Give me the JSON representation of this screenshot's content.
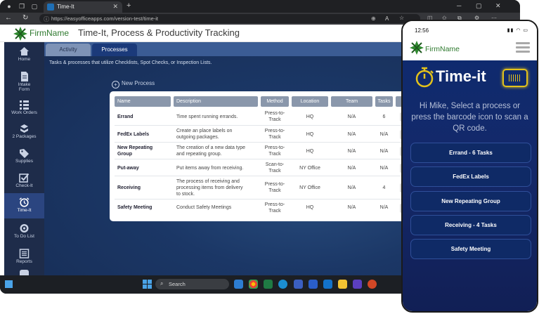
{
  "browser": {
    "tab_title": "Time-It",
    "url_host": "https://easyofficeapps.com",
    "url_path": "/version-test/time-it"
  },
  "app": {
    "logo_text": "FirmName",
    "title": "Time-It, Process & Productivity Tracking"
  },
  "sidebar": {
    "items": [
      {
        "label": "Home",
        "icon": "home-icon"
      },
      {
        "label": "Intake\nForm",
        "icon": "document-icon"
      },
      {
        "label": "Work Orders",
        "icon": "list-icon"
      },
      {
        "label": "2 Packages",
        "icon": "boxes-icon"
      },
      {
        "label": "Supplies",
        "icon": "tag-icon"
      },
      {
        "label": "Check-It",
        "icon": "checkbox-icon"
      },
      {
        "label": "Time-It",
        "icon": "alarm-clock-icon"
      },
      {
        "label": "To Do List",
        "icon": "target-icon"
      },
      {
        "label": "Reports",
        "icon": "report-icon"
      }
    ]
  },
  "tabs": [
    {
      "label": "Activity"
    },
    {
      "label": "Processes"
    }
  ],
  "subtitle": "Tasks & processes that utilize Checklists, Spot Checks, or Inspection Lists.",
  "new_process_label": "New Process",
  "table": {
    "headers": [
      "Name",
      "Description",
      "Method",
      "Location",
      "Team",
      "Tasks"
    ],
    "rows": [
      {
        "name": "Errand",
        "description": "Time spent running errands.",
        "method": "Press-to-\nTrack",
        "location": "HQ",
        "team": "N/A",
        "tasks": "6"
      },
      {
        "name": "FedEx Labels",
        "description": "Create an place labels on\noutgoing packages.",
        "method": "Press-to-\nTrack",
        "location": "HQ",
        "team": "N/A",
        "tasks": "N/A"
      },
      {
        "name": "New Repeating\nGroup",
        "description": "The creation of a new data type\nand repeating group.",
        "method": "Press-to-\nTrack",
        "location": "HQ",
        "team": "N/A",
        "tasks": "N/A"
      },
      {
        "name": "Put-away",
        "description": "Put items away from receiving.",
        "method": "Scan-to-\nTrack",
        "location": "NY Office",
        "team": "N/A",
        "tasks": "N/A"
      },
      {
        "name": "Receiving",
        "description": "The process of receiving and\nprocessing items from delivery\nto stock.",
        "method": "Press-to-\nTrack",
        "location": "NY Office",
        "team": "N/A",
        "tasks": "4"
      },
      {
        "name": "Safety Meeting",
        "description": "Conduct Safety Meetings",
        "method": "Press-to-\nTrack",
        "location": "HQ",
        "team": "N/A",
        "tasks": "N/A"
      }
    ]
  },
  "taskbar": {
    "search_placeholder": "Search"
  },
  "phone": {
    "time": "12:56",
    "logo_text": "FirmName",
    "brand": "Time-it",
    "message": "Hi Mike, Select a process or press the barcode icon to scan a QR code.",
    "buttons": [
      {
        "label": "Errand - 6 Tasks"
      },
      {
        "label": "FedEx Labels"
      },
      {
        "label": "New Repeating Group"
      },
      {
        "label": "Receiving - 4 Tasks"
      },
      {
        "label": "Safety Meeting"
      }
    ]
  },
  "colors": {
    "sidebar": "#1e2c4a",
    "sidebar_active": "#2b4580",
    "brand_green": "#2f7a2f",
    "accent_yellow": "#e3c21b",
    "table_header": "#8a97ab"
  }
}
